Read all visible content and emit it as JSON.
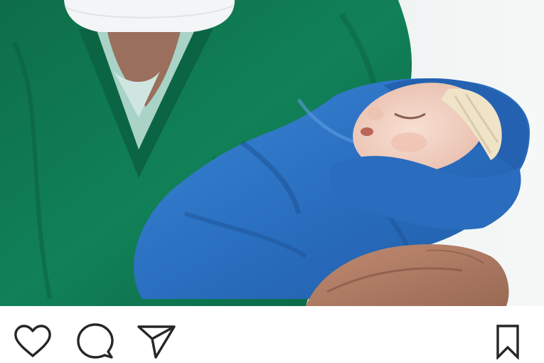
{
  "post": {
    "photo": {
      "subject_icon": "newborn-photo",
      "palette": {
        "scrubs": "#0f7a52",
        "blanket": "#2c74c4",
        "background": "#eaf0f0"
      }
    },
    "actions": {
      "like_icon": "heart-icon",
      "comment_icon": "comment-bubble-icon",
      "share_icon": "send-paper-plane-icon",
      "save_icon": "bookmark-icon",
      "icon_color": "#262626"
    }
  }
}
